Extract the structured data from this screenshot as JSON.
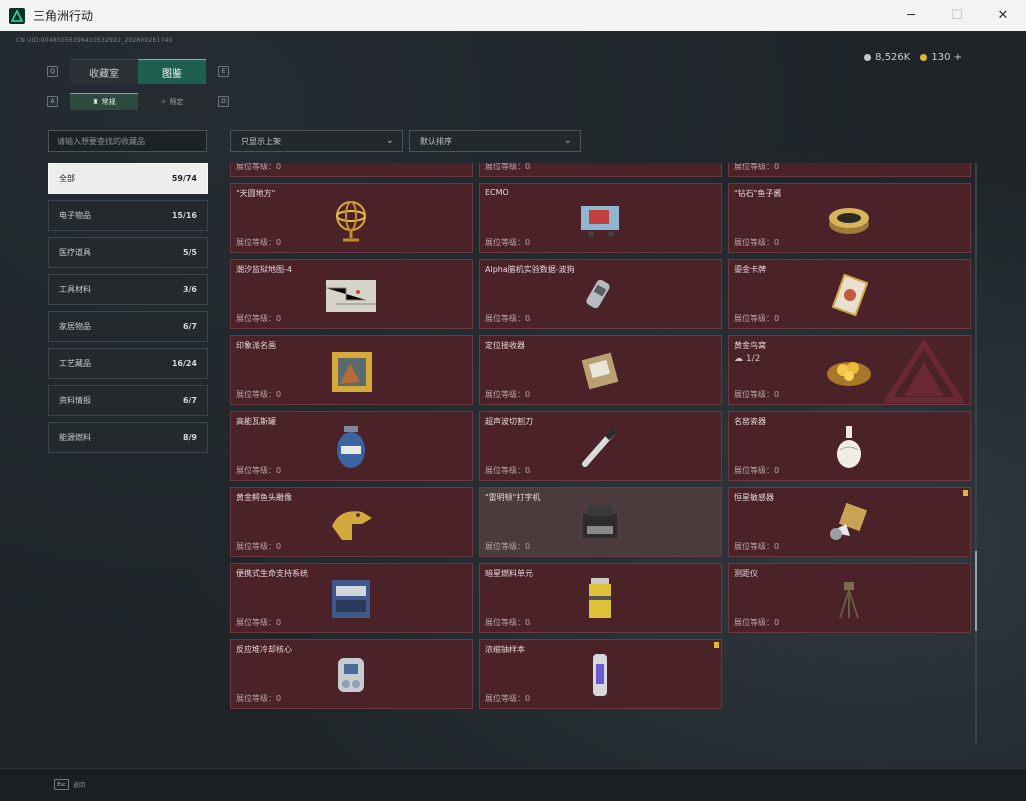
{
  "window": {
    "title": "三角洲行动",
    "minimize": "─",
    "maximize": "☐",
    "close": "✕"
  },
  "uid": "CN UID:904850563964105329​22_2026092617​40",
  "currency": [
    {
      "icon": "silver-coin-icon",
      "value": "8,526K"
    },
    {
      "icon": "gold-coin-icon",
      "value": "130 +"
    }
  ],
  "tabs": {
    "left_key": "Q",
    "right_key": "E",
    "items": [
      "收藏室",
      "图鉴"
    ],
    "active": 1
  },
  "subtabs": {
    "left_key": "A",
    "right_key": "D",
    "items": [
      "常规",
      "限定"
    ],
    "active": 0
  },
  "search": {
    "placeholder": "请输入想要查找的收藏品"
  },
  "filters": {
    "shelf": "只显示上架",
    "sort": "默认排序"
  },
  "categories": [
    {
      "label": "全部",
      "count": "59/74",
      "active": true
    },
    {
      "label": "电子物品",
      "count": "15/16"
    },
    {
      "label": "医疗道具",
      "count": "5/5"
    },
    {
      "label": "工具材料",
      "count": "3/6"
    },
    {
      "label": "家居物品",
      "count": "6/7"
    },
    {
      "label": "工艺藏品",
      "count": "16/24"
    },
    {
      "label": "资料情报",
      "count": "6/7"
    },
    {
      "label": "能源燃料",
      "count": "8/9"
    }
  ],
  "level_label": "展位等级：",
  "items": [
    {
      "name": "",
      "level": "0",
      "icon": "battery-pack-icon"
    },
    {
      "name": "",
      "level": "0",
      "icon": "robot-arm-icon"
    },
    {
      "name": "",
      "level": "0",
      "icon": "gramophone-icon"
    },
    {
      "name": "\"天圆地方\"",
      "level": "0",
      "icon": "armillary-sphere-icon"
    },
    {
      "name": "ECMO",
      "level": "0",
      "icon": "ecmo-machine-icon"
    },
    {
      "name": "\"钻石\"鱼子酱",
      "level": "0",
      "icon": "caviar-tin-icon"
    },
    {
      "name": "潮汐监狱地图-4",
      "level": "0",
      "icon": "map-sheet-icon"
    },
    {
      "name": "Alpha脑机实验数据-波狗",
      "level": "0",
      "icon": "data-canister-icon"
    },
    {
      "name": "鎏金卡牌",
      "level": "0",
      "icon": "gilded-card-icon"
    },
    {
      "name": "印象派名画",
      "level": "0",
      "icon": "painting-frame-icon"
    },
    {
      "name": "定位接收器",
      "level": "0",
      "icon": "receiver-device-icon"
    },
    {
      "name": "黄金鸟窝",
      "level": "0",
      "icon": "golden-nest-icon",
      "sub": "1/2",
      "emblem": true
    },
    {
      "name": "高能瓦斯罐",
      "level": "0",
      "icon": "gas-tank-icon"
    },
    {
      "name": "超声波切割刀",
      "level": "0",
      "icon": "ultrasonic-cutter-icon"
    },
    {
      "name": "名窑瓷器",
      "level": "0",
      "icon": "porcelain-vase-icon"
    },
    {
      "name": "黄金鳄鱼头雕像",
      "level": "0",
      "icon": "gold-crocodile-icon"
    },
    {
      "name": "\"雷明顿\"打字机",
      "level": "0",
      "icon": "typewriter-icon",
      "highlight": true
    },
    {
      "name": "恒星敏感器",
      "level": "0",
      "icon": "star-sensor-icon",
      "flag": true
    },
    {
      "name": "便携式生命支持系统",
      "level": "0",
      "icon": "life-support-icon"
    },
    {
      "name": "暗星燃料单元",
      "level": "0",
      "icon": "fuel-cell-icon"
    },
    {
      "name": "测距仪",
      "level": "0",
      "icon": "rangefinder-tripod-icon"
    },
    {
      "name": "反应堆冷却核心",
      "level": "0",
      "icon": "reactor-core-icon"
    },
    {
      "name": "浓缩铀样本",
      "level": "0",
      "icon": "uranium-sample-icon",
      "flag": true
    }
  ],
  "footer": {
    "key": "Esc",
    "label": "返回"
  },
  "colors": {
    "accent": "#2fe0a6",
    "card_bg": "#4a2228",
    "flag": "#e0b93a"
  }
}
